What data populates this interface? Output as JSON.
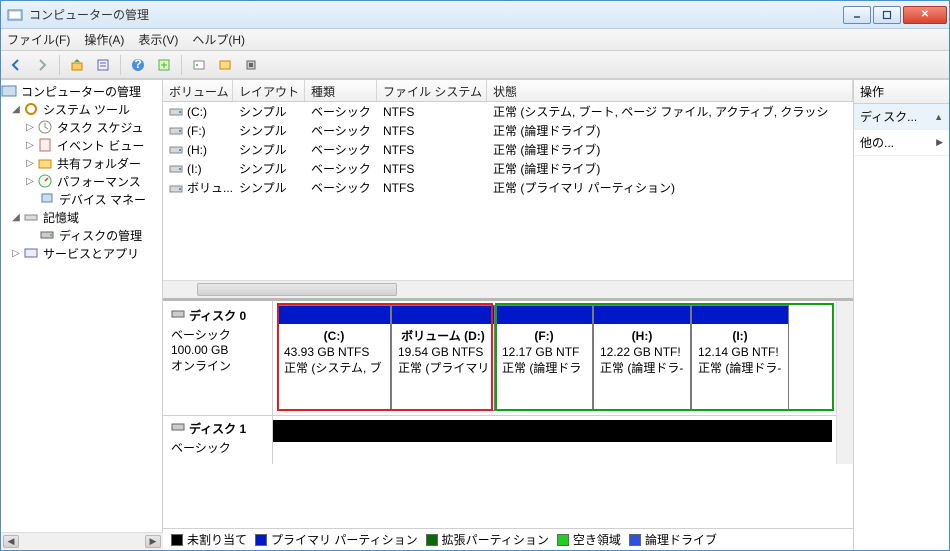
{
  "window": {
    "title": "コンピューターの管理"
  },
  "menu": {
    "file": "ファイル(F)",
    "action": "操作(A)",
    "view": "表示(V)",
    "help": "ヘルプ(H)"
  },
  "tree": {
    "root": "コンピューターの管理",
    "systools": "システム ツール",
    "task": "タスク スケジュ",
    "event": "イベント ビュー",
    "shared": "共有フォルダー",
    "perf": "パフォーマンス",
    "devmgr": "デバイス マネー",
    "storage": "記憶域",
    "diskmgmt": "ディスクの管理",
    "services": "サービスとアプリ"
  },
  "cols": {
    "vol": "ボリューム",
    "layout": "レイアウト",
    "type": "種類",
    "fs": "ファイル システム",
    "status": "状態"
  },
  "rows": [
    {
      "vol": "(C:)",
      "layout": "シンプル",
      "type": "ベーシック",
      "fs": "NTFS",
      "status": "正常 (システム, ブート, ページ ファイル, アクティブ, クラッシ"
    },
    {
      "vol": "(F:)",
      "layout": "シンプル",
      "type": "ベーシック",
      "fs": "NTFS",
      "status": "正常 (論理ドライブ)"
    },
    {
      "vol": "(H:)",
      "layout": "シンプル",
      "type": "ベーシック",
      "fs": "NTFS",
      "status": "正常 (論理ドライブ)"
    },
    {
      "vol": "(I:)",
      "layout": "シンプル",
      "type": "ベーシック",
      "fs": "NTFS",
      "status": "正常 (論理ドライブ)"
    },
    {
      "vol": "ボリュ...",
      "layout": "シンプル",
      "type": "ベーシック",
      "fs": "NTFS",
      "status": "正常 (プライマリ パーティション)"
    }
  ],
  "disk0": {
    "name": "ディスク 0",
    "kind": "ベーシック",
    "size": "100.00 GB",
    "state": "オンライン",
    "parts": [
      {
        "n": "(C:)",
        "sz": "43.93 GB NTFS",
        "st": "正常 (システム, ブ"
      },
      {
        "n": "ボリューム  (D:)",
        "sz": "19.54 GB NTFS",
        "st": "正常 (プライマリ"
      },
      {
        "n": "(F:)",
        "sz": "12.17 GB NTF",
        "st": "正常 (論理ドラ"
      },
      {
        "n": "(H:)",
        "sz": "12.22 GB NTF!",
        "st": "正常 (論理ドラ-"
      },
      {
        "n": "(I:)",
        "sz": "12.14 GB NTF!",
        "st": "正常 (論理ドラ-"
      }
    ]
  },
  "disk1": {
    "name": "ディスク 1",
    "kind": "ベーシック"
  },
  "legend": {
    "unalloc": "未割り当て",
    "primary": "プライマリ パーティション",
    "ext": "拡張パーティション",
    "free": "空き領域",
    "logical": "論理ドライブ"
  },
  "actions": {
    "hdr": "操作",
    "disk": "ディスク...",
    "other": "他の..."
  }
}
